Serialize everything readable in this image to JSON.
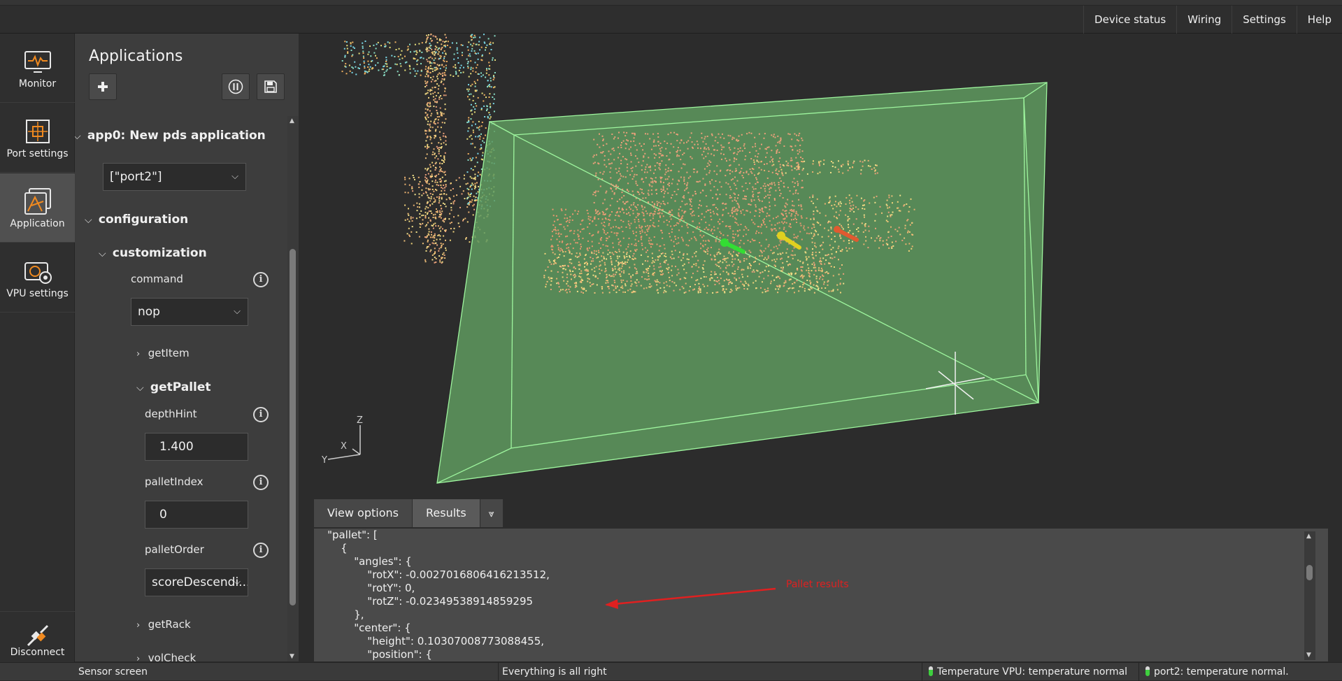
{
  "topnav": {
    "items": [
      "Device status",
      "Wiring",
      "Settings",
      "Help"
    ]
  },
  "leftnav": {
    "items": [
      {
        "label": "Monitor",
        "icon": "monitor-icon"
      },
      {
        "label": "Port settings",
        "icon": "port-settings-icon"
      },
      {
        "label": "Application",
        "icon": "application-icon",
        "active": true
      },
      {
        "label": "VPU settings",
        "icon": "vpu-settings-icon"
      }
    ],
    "disconnect": {
      "label": "Disconnect",
      "icon": "disconnect-icon"
    }
  },
  "panel": {
    "title": "Applications",
    "add_icon": "plus-icon",
    "pause_icon": "pause-icon",
    "save_icon": "save-icon",
    "app_node": "app0: New pds application",
    "ports_value": "[\"port2\"]",
    "configuration": "configuration",
    "customization": "customization",
    "command_label": "command",
    "command_value": "nop",
    "getItem": "getItem",
    "getPallet": "getPallet",
    "depthHint_label": "depthHint",
    "depthHint_value": "1.400",
    "palletIndex_label": "palletIndex",
    "palletIndex_value": "0",
    "palletOrder_label": "palletOrder",
    "palletOrder_value": "scoreDescendi...",
    "getRack": "getRack",
    "volCheck": "volCheck"
  },
  "viewport": {
    "axes": {
      "z": "Z",
      "x": "X",
      "y": "Y"
    },
    "colors": {
      "volume_fill": "#5f9a5f",
      "volume_edge": "#9ef59e",
      "pointcloud": "#e9a07a"
    }
  },
  "tabs": {
    "view_options": "View options",
    "results": "Results"
  },
  "results": {
    "lines": [
      "    \"pallet\": [",
      "        {",
      "            \"angles\": {",
      "                \"rotX\": -0.0027016806416213512,",
      "                \"rotY\": 0,",
      "                \"rotZ\": -0.02349538914859295",
      "            },",
      "            \"center\": {",
      "                \"height\": 0.10307008773088455,",
      "                \"position\": {"
    ],
    "annotation": "Pallet results"
  },
  "statusbar": {
    "screen": "Sensor screen",
    "message": "Everything is all right",
    "temp_vpu": "Temperature VPU: temperature normal",
    "port2": "port2: temperature normal."
  }
}
